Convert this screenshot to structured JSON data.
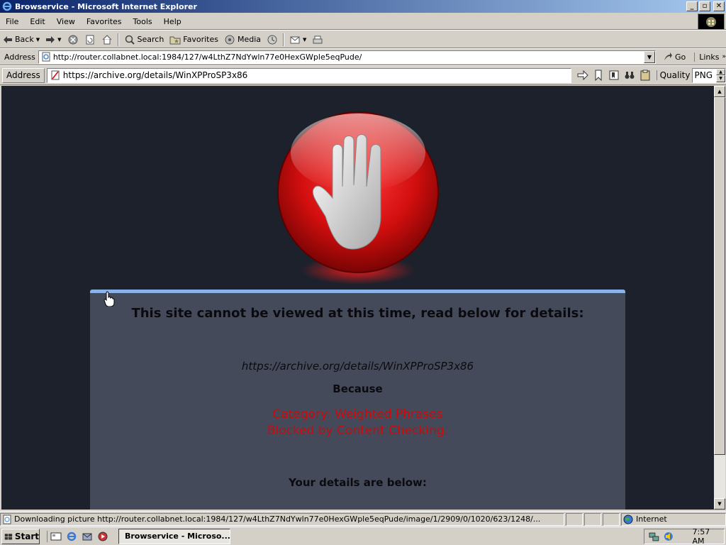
{
  "window": {
    "title": "Browservice - Microsoft Internet Explorer",
    "buttons": [
      "minimize",
      "maximize",
      "close"
    ]
  },
  "menu": [
    "File",
    "Edit",
    "View",
    "Favorites",
    "Tools",
    "Help"
  ],
  "toolbar": {
    "back": "Back",
    "search": "Search",
    "favorites": "Favorites",
    "media": "Media"
  },
  "address": {
    "label": "Address",
    "url": "http://router.collabnet.local:1984/127/w4LthZ7NdYwln77e0HexGWple5eqPude/",
    "go": "Go",
    "links": "Links"
  },
  "browservice": {
    "address_label": "Address",
    "url": "https://archive.org/details/WinXPProSP3x86",
    "quality_label": "Quality",
    "quality_value": "PNG"
  },
  "page": {
    "headline": "This site cannot be viewed at this time, read below for details:",
    "blocked_url": "https://archive.org/details/WinXPProSP3x86",
    "because": "Because",
    "reason_line1": "Category: Weighted Phrases",
    "reason_line2": "Blocked by Content Checking.",
    "details": "Your details are below:"
  },
  "status": {
    "text": "Downloading picture http://router.collabnet.local:1984/127/w4LthZ7NdYwln77e0HexGWple5eqPude/image/1/2909/0/1020/623/1248/...",
    "zone": "Internet"
  },
  "taskbar": {
    "start": "Start",
    "task": "Browservice - Microso...",
    "clock": "7:57 AM"
  },
  "colors": {
    "page_bg": "#1d212b",
    "panel_bg": "#444a5a",
    "panel_accent": "#8ab4e8",
    "reason_red": "#cc0a0a"
  }
}
